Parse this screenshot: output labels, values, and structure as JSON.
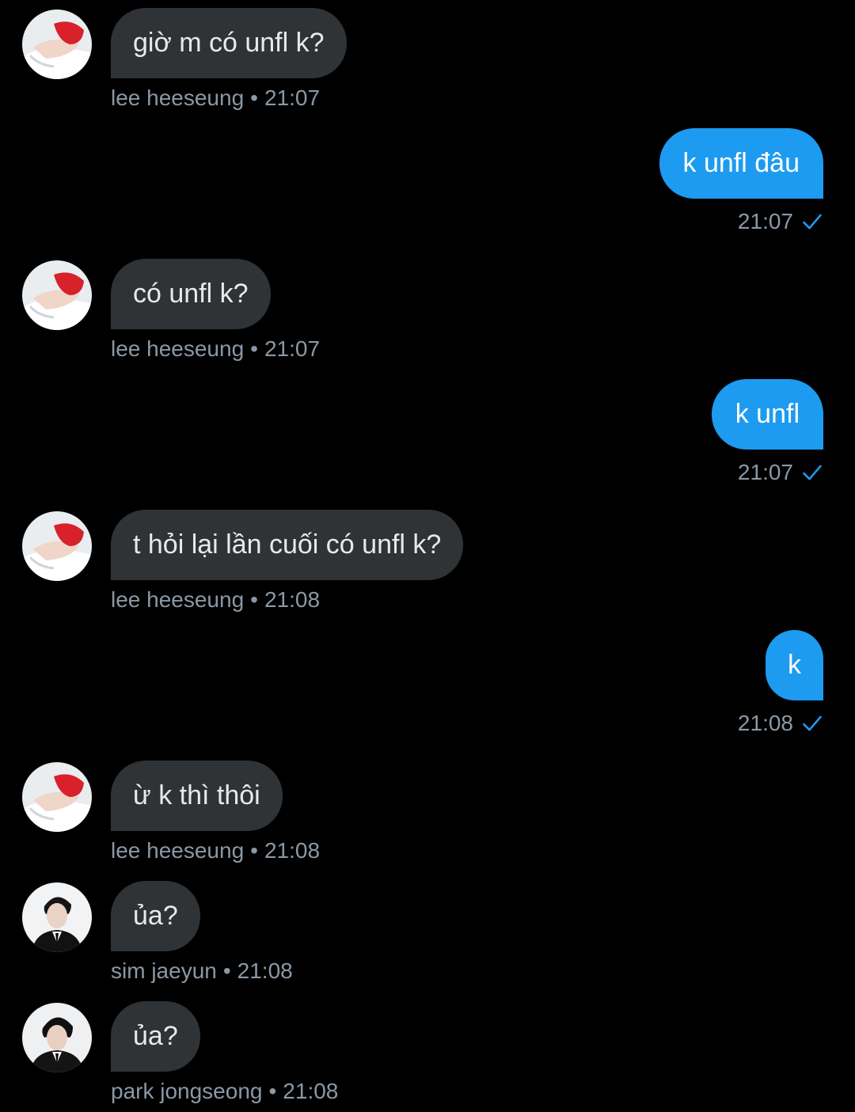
{
  "colors": {
    "background": "#000000",
    "incoming_bubble": "#2f3336",
    "outgoing_bubble": "#1d9bf0",
    "meta_text": "#8b98a5",
    "read_check": "#1d9bf0"
  },
  "messages": [
    {
      "direction": "in",
      "avatar": "heeseung-avatar",
      "text": "giờ m có unfl k?",
      "sender": "lee heeseung",
      "dot": "•",
      "time": "21:07"
    },
    {
      "direction": "out",
      "text": "k unfl đâu",
      "time": "21:07",
      "status_icon": "read-check-icon"
    },
    {
      "direction": "in",
      "avatar": "heeseung-avatar",
      "text": "có unfl k?",
      "sender": "lee heeseung",
      "dot": "•",
      "time": "21:07"
    },
    {
      "direction": "out",
      "text": "k unfl",
      "time": "21:07",
      "status_icon": "read-check-icon"
    },
    {
      "direction": "in",
      "avatar": "heeseung-avatar",
      "text": "t hỏi lại lần cuối có unfl k?",
      "sender": "lee heeseung",
      "dot": "•",
      "time": "21:08"
    },
    {
      "direction": "out",
      "text": "k",
      "time": "21:08",
      "status_icon": "read-check-icon"
    },
    {
      "direction": "in",
      "avatar": "heeseung-avatar",
      "text": "ừ k thì thôi",
      "sender": "lee heeseung",
      "dot": "•",
      "time": "21:08"
    },
    {
      "direction": "in",
      "avatar": "jaeyun-avatar",
      "text": "ủa?",
      "sender": "sim jaeyun",
      "dot": "•",
      "time": "21:08"
    },
    {
      "direction": "in",
      "avatar": "jongseong-avatar",
      "text": "ủa?",
      "sender": "park jongseong",
      "dot": "•",
      "time": "21:08"
    }
  ]
}
